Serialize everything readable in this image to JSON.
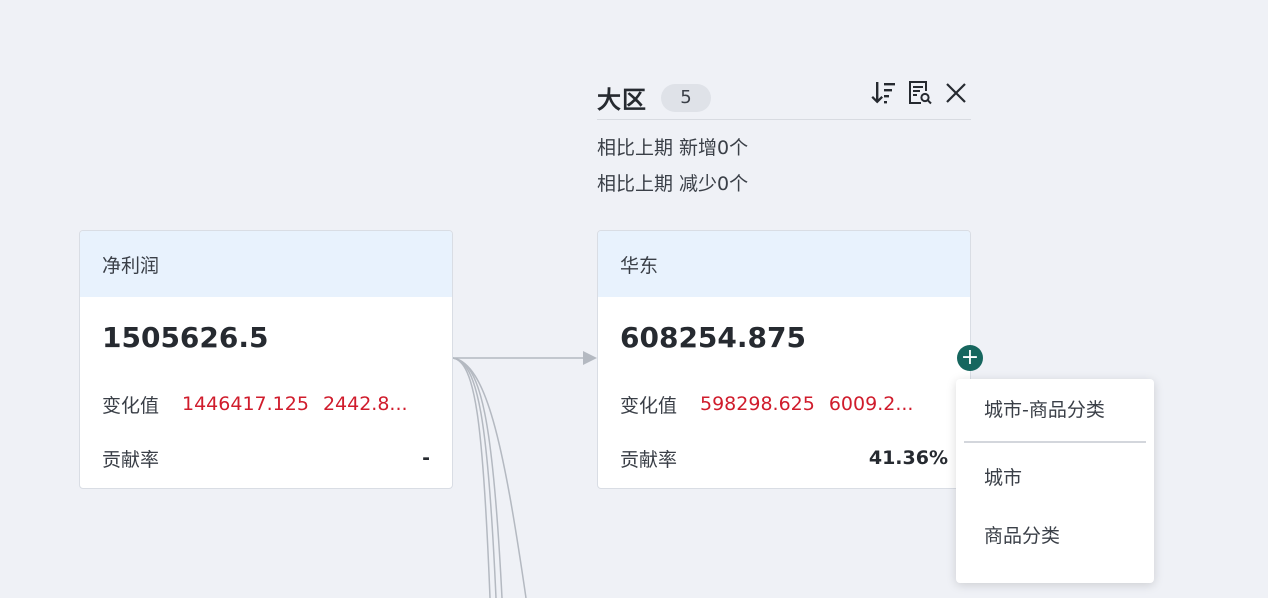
{
  "group": {
    "title": "大区",
    "count": "5",
    "added_text": "相比上期 新增0个",
    "removed_text": "相比上期 减少0个"
  },
  "cards": [
    {
      "header": "净利润",
      "value": "1505626.5",
      "change_label": "变化值",
      "change_values": [
        "1446417.125",
        "2442.8..."
      ],
      "contribution_label": "贡献率",
      "contribution_value": "-"
    },
    {
      "header": "华东",
      "value": "608254.875",
      "change_label": "变化值",
      "change_values": [
        "598298.625",
        "6009.2..."
      ],
      "contribution_label": "贡献率",
      "contribution_value": "41.36%"
    }
  ],
  "add_button": {
    "label": "+"
  },
  "dropdown": {
    "items": [
      "城市-商品分类",
      "城市",
      "商品分类"
    ]
  },
  "colors": {
    "background": "#eff1f6",
    "card_header": "#e8f2fd",
    "negative_value": "#d01c2c",
    "add_button": "#16665e"
  },
  "icons": [
    "sort-icon",
    "report-search-icon",
    "close-icon",
    "plus-icon"
  ]
}
